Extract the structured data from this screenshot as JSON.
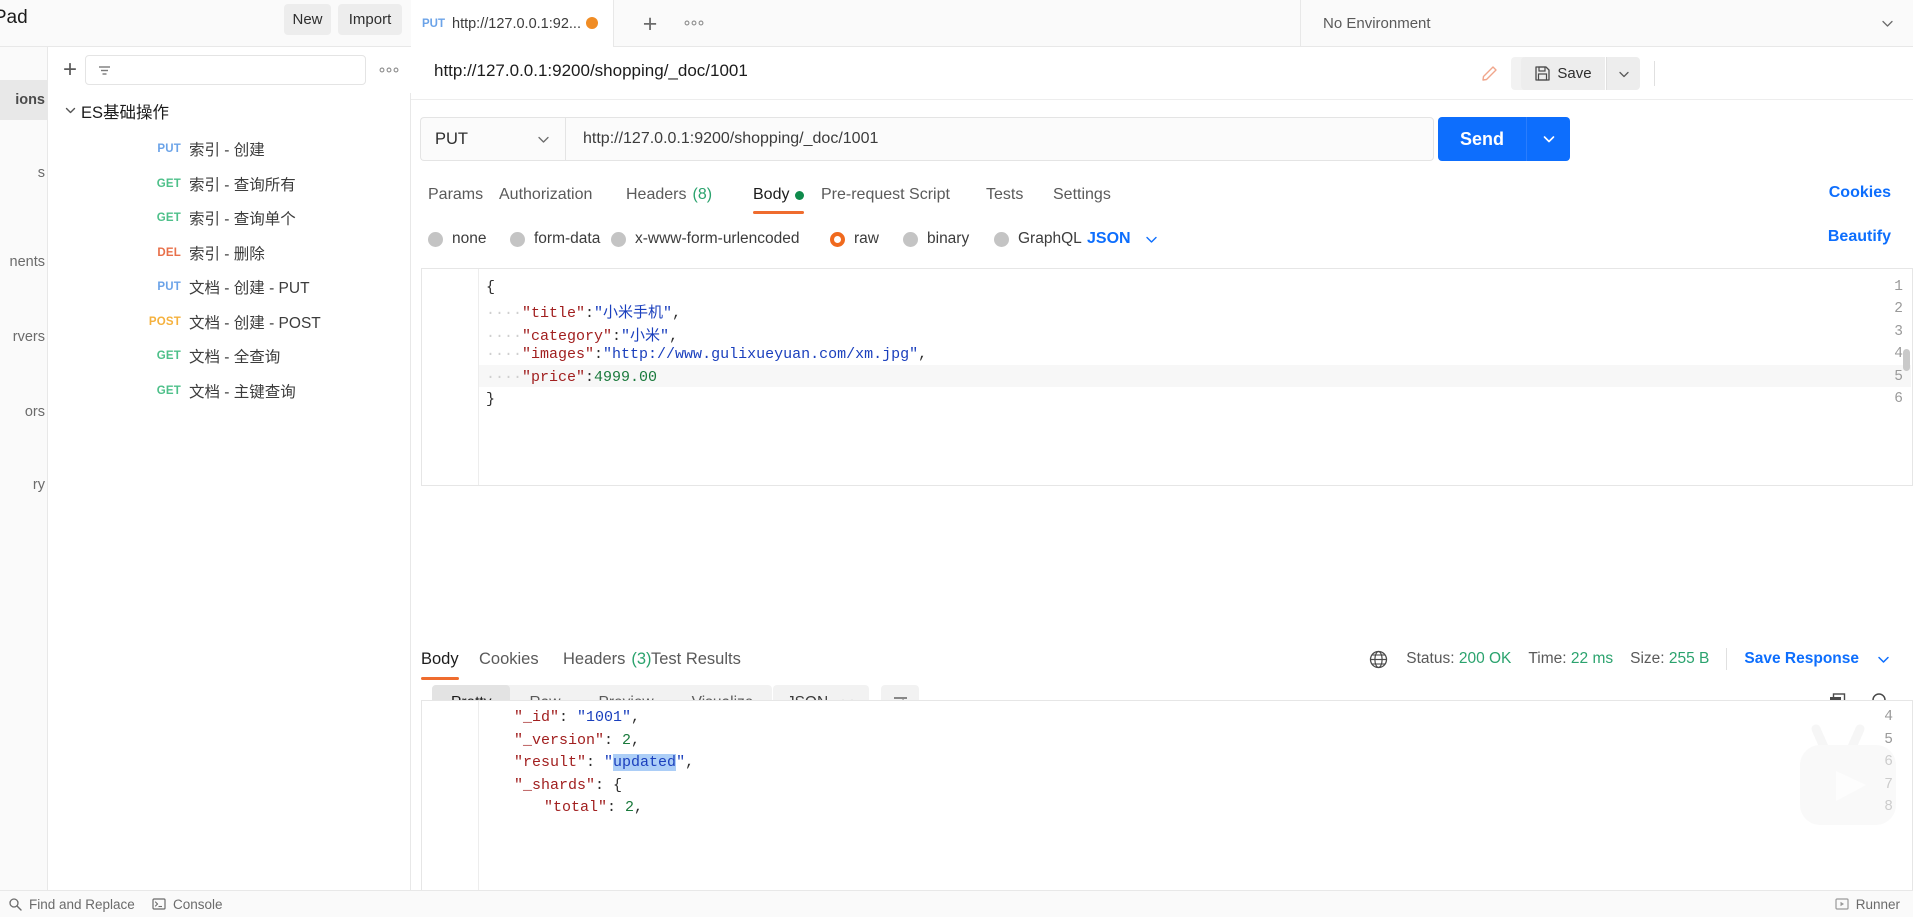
{
  "sidebar": {
    "workspace_title": "h Pad",
    "new_label": "New",
    "import_label": "Import",
    "filter_placeholder": "",
    "more_label": "●●●",
    "edge_items": [
      {
        "label": "ions",
        "full": "Collections",
        "active": true
      },
      {
        "label": "s",
        "full": "APIs",
        "active": false
      },
      {
        "label": "nents",
        "full": "Environments",
        "active": false
      },
      {
        "label": "rvers",
        "full": "Mock Servers",
        "active": false
      },
      {
        "label": "ors",
        "full": "Monitors",
        "active": false
      },
      {
        "label": "ry",
        "full": "History",
        "active": false
      }
    ],
    "collection": {
      "name": "ES基础操作",
      "expanded": true,
      "requests": [
        {
          "method": "PUT",
          "label": "索引 - 创建"
        },
        {
          "method": "GET",
          "label": "索引 - 查询所有"
        },
        {
          "method": "GET",
          "label": "索引 - 查询单个"
        },
        {
          "method": "DEL",
          "label": "索引 - 删除"
        },
        {
          "method": "PUT",
          "label": "文档 - 创建 - PUT"
        },
        {
          "method": "POST",
          "label": "文档 - 创建 - POST"
        },
        {
          "method": "GET",
          "label": "文档 - 全查询"
        },
        {
          "method": "GET",
          "label": "文档 - 主键查询"
        }
      ]
    }
  },
  "tabbar": {
    "tab_method": "PUT",
    "tab_name": "http://127.0.0.1:92...",
    "unsaved": true,
    "add_label": "+",
    "more_label": "●●●"
  },
  "environment": {
    "selected": "No Environment"
  },
  "request_header": {
    "title": "http://127.0.0.1:9200/shopping/_doc/1001",
    "save_label": "Save"
  },
  "request": {
    "method": "PUT",
    "url": "http://127.0.0.1:9200/shopping/_doc/1001",
    "send_label": "Send",
    "tabs": [
      {
        "label": "Params",
        "active": false
      },
      {
        "label": "Authorization",
        "active": false
      },
      {
        "label": "Headers",
        "active": false,
        "count": "(8)"
      },
      {
        "label": "Body",
        "active": true,
        "dot": true
      },
      {
        "label": "Pre-request Script",
        "active": false
      },
      {
        "label": "Tests",
        "active": false
      },
      {
        "label": "Settings",
        "active": false
      }
    ],
    "cookies_link": "Cookies",
    "body_types": [
      {
        "label": "none",
        "selected": false
      },
      {
        "label": "form-data",
        "selected": false
      },
      {
        "label": "x-www-form-urlencoded",
        "selected": false
      },
      {
        "label": "raw",
        "selected": true
      },
      {
        "label": "binary",
        "selected": false
      },
      {
        "label": "GraphQL",
        "selected": false
      }
    ],
    "raw_format": "JSON",
    "beautify_label": "Beautify",
    "body_lines": [
      {
        "n": "1",
        "segs": [
          {
            "t": "{",
            "c": "tk-b"
          }
        ]
      },
      {
        "n": "2",
        "segs": [
          {
            "t": "····",
            "c": "tk-d"
          },
          {
            "t": "\"title\"",
            "c": "tk-p"
          },
          {
            "t": ":",
            "c": "tk-b"
          },
          {
            "t": "\"小米手机\"",
            "c": "tk-s"
          },
          {
            "t": ",",
            "c": "tk-b"
          }
        ]
      },
      {
        "n": "3",
        "segs": [
          {
            "t": "····",
            "c": "tk-d"
          },
          {
            "t": "\"category\"",
            "c": "tk-p"
          },
          {
            "t": ":",
            "c": "tk-b"
          },
          {
            "t": "\"小米\"",
            "c": "tk-s"
          },
          {
            "t": ",",
            "c": "tk-b"
          }
        ]
      },
      {
        "n": "4",
        "segs": [
          {
            "t": "····",
            "c": "tk-d"
          },
          {
            "t": "\"images\"",
            "c": "tk-p"
          },
          {
            "t": ":",
            "c": "tk-b"
          },
          {
            "t": "\"http://www.gulixueyuan.com/xm.jpg\"",
            "c": "tk-s"
          },
          {
            "t": ",",
            "c": "tk-b"
          }
        ]
      },
      {
        "n": "5",
        "segs": [
          {
            "t": "····",
            "c": "tk-d"
          },
          {
            "t": "\"price\"",
            "c": "tk-p"
          },
          {
            "t": ":",
            "c": "tk-b"
          },
          {
            "t": "4999.00",
            "c": "tk-n"
          }
        ]
      },
      {
        "n": "6",
        "segs": [
          {
            "t": "}",
            "c": "tk-b"
          }
        ]
      }
    ]
  },
  "response": {
    "tabs": [
      {
        "label": "Body",
        "active": true
      },
      {
        "label": "Cookies",
        "active": false
      },
      {
        "label": "Headers",
        "active": false,
        "count": "(3)"
      },
      {
        "label": "Test Results",
        "active": false
      }
    ],
    "status_key": "Status:",
    "status_value": "200 OK",
    "time_key": "Time:",
    "time_value": "22 ms",
    "size_key": "Size:",
    "size_value": "255 B",
    "save_response_label": "Save Response",
    "view_modes": [
      {
        "label": "Pretty",
        "active": true
      },
      {
        "label": "Raw",
        "active": false
      },
      {
        "label": "Preview",
        "active": false
      },
      {
        "label": "Visualize",
        "active": false
      }
    ],
    "format": "JSON",
    "body_lines": [
      {
        "n": "4",
        "indent": 0,
        "segs": [
          {
            "t": "\"_id\"",
            "c": "tk-p"
          },
          {
            "t": ": ",
            "c": "tk-b"
          },
          {
            "t": "\"1001\"",
            "c": "tk-s"
          },
          {
            "t": ",",
            "c": "tk-b"
          }
        ]
      },
      {
        "n": "5",
        "indent": 0,
        "segs": [
          {
            "t": "\"_version\"",
            "c": "tk-p"
          },
          {
            "t": ": ",
            "c": "tk-b"
          },
          {
            "t": "2",
            "c": "tk-n"
          },
          {
            "t": ",",
            "c": "tk-b"
          }
        ]
      },
      {
        "n": "6",
        "indent": 0,
        "segs": [
          {
            "t": "\"result\"",
            "c": "tk-p"
          },
          {
            "t": ": ",
            "c": "tk-b"
          },
          {
            "t": "\"",
            "c": "tk-s"
          },
          {
            "t": "updated",
            "c": "tk-s sel"
          },
          {
            "t": "\"",
            "c": "tk-s"
          },
          {
            "t": ",",
            "c": "tk-b"
          }
        ]
      },
      {
        "n": "7",
        "indent": 0,
        "segs": [
          {
            "t": "\"_shards\"",
            "c": "tk-p"
          },
          {
            "t": ": {",
            "c": "tk-b"
          }
        ]
      },
      {
        "n": "8",
        "indent": 1,
        "segs": [
          {
            "t": "\"total\"",
            "c": "tk-p"
          },
          {
            "t": ": ",
            "c": "tk-b"
          },
          {
            "t": "2",
            "c": "tk-n"
          },
          {
            "t": ",",
            "c": "tk-b"
          }
        ]
      }
    ],
    "selected_text": "updated"
  },
  "statusbar": {
    "find_label": "Find and Replace",
    "console_label": "Console",
    "runner_label": "Runner"
  },
  "colors": {
    "accent_blue": "#0d6efd",
    "accent_orange": "#ef6c2e",
    "success_green": "#2ba36e",
    "put": "#6ba3e8",
    "get": "#4ec08a",
    "del": "#e8704a",
    "post": "#f5b13d"
  }
}
